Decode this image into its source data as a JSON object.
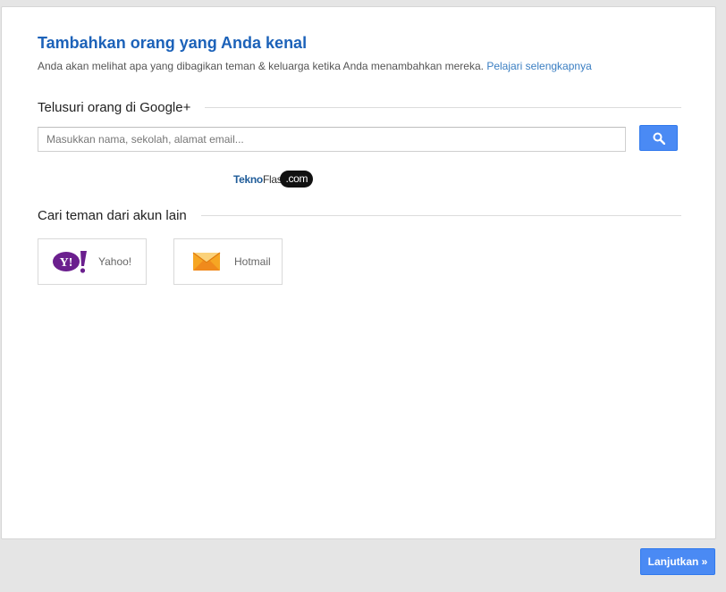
{
  "header": {
    "title": "Tambahkan orang yang Anda kenal",
    "subtitle": "Anda akan melihat apa yang dibagikan teman & keluarga ketika Anda menambahkan mereka.",
    "learn_more": "Pelajari selengkapnya"
  },
  "search_section": {
    "heading": "Telusuri orang di Google+",
    "placeholder": "Masukkan nama, sekolah, alamat email...",
    "button_icon": "search-icon"
  },
  "watermark": {
    "part1": "Tekno",
    "part2": "Flas",
    "part3": ".com"
  },
  "other_accounts": {
    "heading": "Cari teman dari akun lain",
    "providers": [
      {
        "label": "Yahoo!",
        "icon": "yahoo-logo-icon",
        "color": "#6b1f8e"
      },
      {
        "label": "Hotmail",
        "icon": "envelope-icon",
        "color": "#f08a1c"
      }
    ]
  },
  "footer": {
    "continue_label": "Lanjutkan »"
  },
  "colors": {
    "accent": "#4a8af4",
    "title": "#1c62b9",
    "link": "#3a7ec2"
  }
}
